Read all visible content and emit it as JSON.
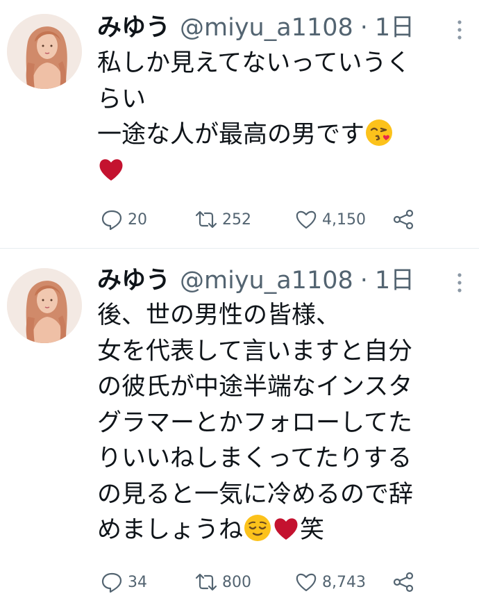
{
  "tweets": [
    {
      "name": "みゆう",
      "handle": "@miyu_a1108",
      "separator": "·",
      "time": "1日",
      "lines": [
        "私しか見えてないっていうく",
        "らい",
        "一途な人が最高の男です"
      ],
      "emojis": [
        "kissing-face-emoji",
        "red-heart-emoji"
      ],
      "replies": "20",
      "retweets": "252",
      "likes": "4,150"
    },
    {
      "name": "みゆう",
      "handle": "@miyu_a1108",
      "separator": "·",
      "time": "1日",
      "lines": [
        "後、世の男性の皆様、",
        "女を代表して言いますと自分",
        "の彼氏が中途半端なインスタ",
        "グラマーとかフォローしてた",
        "りいいねしまくってたりする",
        "の見ると一気に冷めるので辞",
        "めましょうね",
        "笑"
      ],
      "emojis": [
        "relieved-face-emoji",
        "red-heart-emoji"
      ],
      "replies": "34",
      "retweets": "800",
      "likes": "8,743"
    }
  ],
  "colors": {
    "text": "#0f1419",
    "secondary": "#536471",
    "divider": "#e6ecf0",
    "heart": "#c4122f",
    "emoji_yellow": "#fcc21b"
  }
}
